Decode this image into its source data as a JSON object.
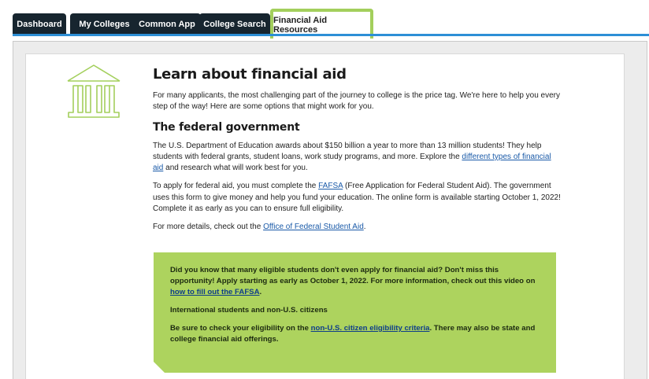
{
  "tabs": [
    {
      "label": "Dashboard",
      "active": false
    },
    {
      "label": "My Colleges",
      "active": false
    },
    {
      "label": "Common App",
      "active": false
    },
    {
      "label": "College Search",
      "active": false
    },
    {
      "label": "Financial Aid Resources",
      "active": true
    }
  ],
  "colors": {
    "tab_bg": "#17252f",
    "active_border": "#a3cf5c",
    "accent_line": "#2d8fd6",
    "callout_bg": "#add35e",
    "icon": "#a3cf5c",
    "link": "#1a5aa8"
  },
  "icon": "bank-building-icon",
  "main": {
    "title": "Learn about financial aid",
    "intro": "For many applicants, the most challenging part of the journey to college is the price tag. We're here to help you every step of the way! Here are some options that might work for you.",
    "federal_heading": "The federal government",
    "p1_before": "The U.S. Department of Education awards about $150 billion a year to more than 13 million students! They help students with federal grants, student loans, work study programs, and more. Explore the ",
    "p1_link": "different types of financial aid",
    "p1_after": " and research what will work best for you.",
    "p2_before": "To apply for federal aid, you must complete the ",
    "p2_link": "FAFSA",
    "p2_after": " (Free Application for Federal Student Aid). The government uses this form to give money and help you fund your education. The online form is available starting October 1, 2022! Complete it as early as you can to ensure full eligibility.",
    "p3_before": "For more details, check out the ",
    "p3_link": "Office of Federal Student Aid",
    "p3_after": "."
  },
  "callout": {
    "p1_before": "Did you know that many eligible students don't even apply for financial aid? Don't miss this opportunity! Apply starting as early as October 1, 2022. For more information, check out this video on ",
    "p1_link": "how to fill out the FAFSA",
    "p1_after": ".",
    "intl_heading": "International students and non-U.S. citizens",
    "p2_before": "Be sure to check your eligibility on the ",
    "p2_link": "non-U.S. citizen eligibility criteria",
    "p2_after": ". There may also be state and college financial aid offerings."
  }
}
